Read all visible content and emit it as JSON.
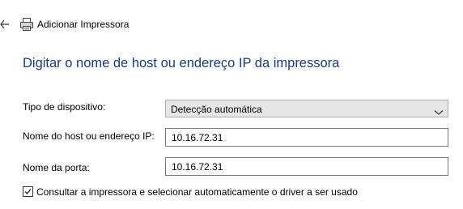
{
  "header": {
    "back_icon": "arrow-left-icon",
    "app_icon": "printer-icon",
    "title": "Adicionar Impressora"
  },
  "main": {
    "heading": "Digitar o nome de host ou endereço IP da impressora",
    "device_type": {
      "label": "Tipo de dispositivo:",
      "selected": "Detecção automática"
    },
    "host": {
      "label": "Nome do host ou endereço IP:",
      "value": "10.16.72.31"
    },
    "port": {
      "label": "Nome da porta:",
      "value": "10.16.72.31"
    },
    "query_printer": {
      "label": "Consultar a impressora e selecionar automaticamente o driver a ser usado",
      "checked": true
    }
  },
  "colors": {
    "heading": "#1a3a7a",
    "select_bg": "#e6e6e6",
    "input_border": "#7a7a7a"
  }
}
